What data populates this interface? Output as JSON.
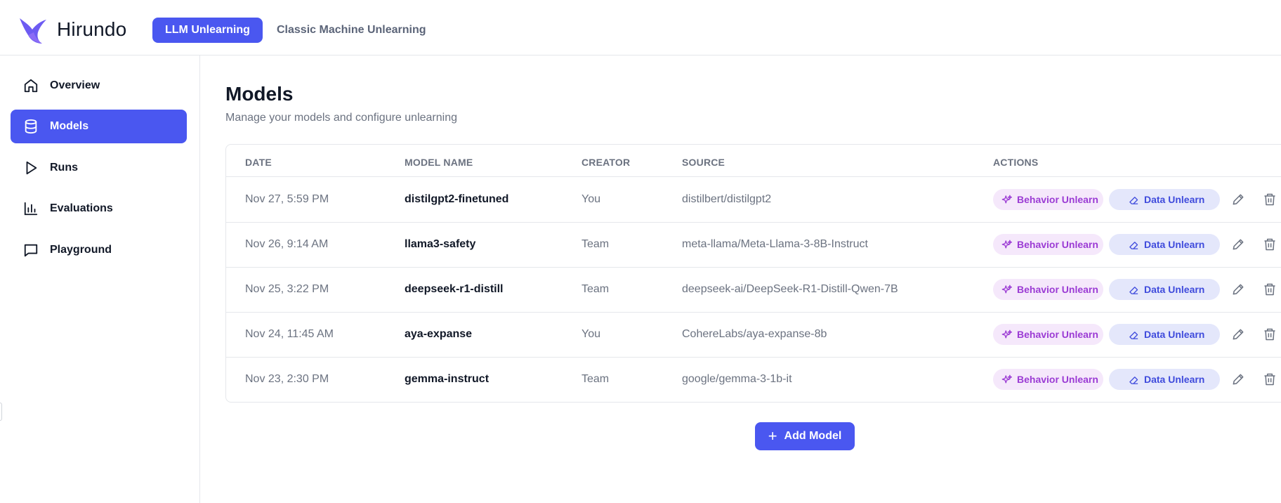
{
  "app": {
    "brand": "Hirundo",
    "brand_color": "#4a57f0",
    "logo_icon": "swallow-logo-icon"
  },
  "top_nav": {
    "tabs": [
      {
        "label": "LLM Unlearning",
        "active": true
      },
      {
        "label": "Classic Machine Unlearning",
        "active": false
      }
    ]
  },
  "sidebar": {
    "items": [
      {
        "label": "Overview",
        "icon": "home-icon",
        "active": false
      },
      {
        "label": "Models",
        "icon": "database-icon",
        "active": true
      },
      {
        "label": "Runs",
        "icon": "play-icon",
        "active": false
      },
      {
        "label": "Evaluations",
        "icon": "bar-chart-icon",
        "active": false
      },
      {
        "label": "Playground",
        "icon": "chat-icon",
        "active": false
      }
    ]
  },
  "main": {
    "title": "Models",
    "subtitle": "Manage your models and configure unlearning",
    "columns": [
      "DATE",
      "MODEL NAME",
      "CREATOR",
      "SOURCE",
      "ACTIONS"
    ],
    "rows": [
      {
        "date": "Nov 27, 5:59 PM",
        "name": "distilgpt2-finetuned",
        "creator": "You",
        "source": "distilbert/distilgpt2"
      },
      {
        "date": "Nov 26, 9:14 AM",
        "name": "llama3-safety",
        "creator": "Team",
        "source": "meta-llama/Meta-Llama-3-8B-Instruct"
      },
      {
        "date": "Nov 25, 3:22 PM",
        "name": "deepseek-r1-distill",
        "creator": "Team",
        "source": "deepseek-ai/DeepSeek-R1-Distill-Qwen-7B"
      },
      {
        "date": "Nov 24, 11:45 AM",
        "name": "aya-expanse",
        "creator": "You",
        "source": "CohereLabs/aya-expanse-8b"
      },
      {
        "date": "Nov 23, 2:30 PM",
        "name": "gemma-instruct",
        "creator": "Team",
        "source": "google/gemma-3-1b-it"
      }
    ],
    "actions": {
      "behavior_label": "Behavior Unlearn",
      "data_label": "Data Unlearn",
      "behavior_color": "#9b3bd4",
      "data_color": "#3f4bdc"
    },
    "add_button_label": "Add Model"
  }
}
